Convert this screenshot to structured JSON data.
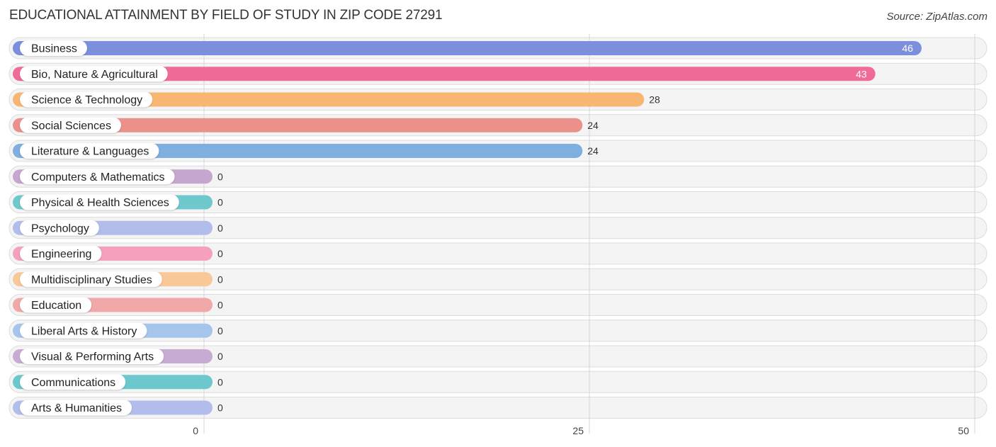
{
  "chart_data": {
    "type": "bar",
    "orientation": "horizontal",
    "title": "EDUCATIONAL ATTAINMENT BY FIELD OF STUDY IN ZIP CODE 27291",
    "source": "Source: ZipAtlas.com",
    "xlabel": "",
    "ylabel": "",
    "xlim": [
      0,
      50
    ],
    "xticks": [
      0,
      25,
      50
    ],
    "grid": true,
    "categories": [
      "Business",
      "Bio, Nature & Agricultural",
      "Science & Technology",
      "Social Sciences",
      "Literature & Languages",
      "Computers & Mathematics",
      "Physical & Health Sciences",
      "Psychology",
      "Engineering",
      "Multidisciplinary Studies",
      "Education",
      "Liberal Arts & History",
      "Visual & Performing Arts",
      "Communications",
      "Arts & Humanities"
    ],
    "values": [
      46,
      43,
      28,
      24,
      24,
      0,
      0,
      0,
      0,
      0,
      0,
      0,
      0,
      0,
      0
    ],
    "colors": [
      "#7b8fdc",
      "#f06b98",
      "#f9b673",
      "#ec908c",
      "#7eafe0",
      "#c6a6cf",
      "#6fc8cc",
      "#b3bdeb",
      "#f5a0bd",
      "#f9c898",
      "#f0a8a8",
      "#a6c5ec",
      "#c7abd2",
      "#6cc8cc",
      "#b3bdeb"
    ],
    "value_labels_inside": [
      true,
      true,
      false,
      false,
      false,
      false,
      false,
      false,
      false,
      false,
      false,
      false,
      false,
      false,
      false
    ]
  }
}
